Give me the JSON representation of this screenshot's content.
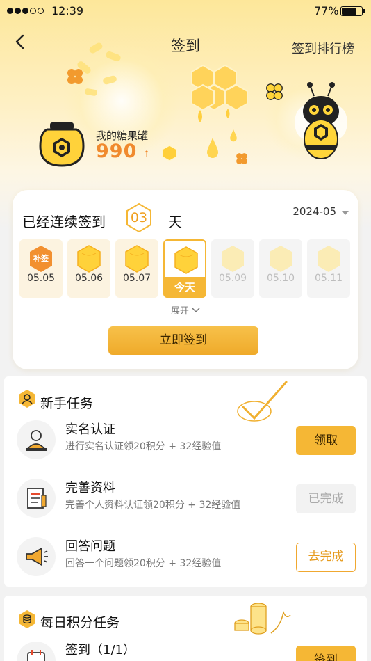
{
  "status_bar": {
    "time": "12:39",
    "battery_pct": "77%"
  },
  "nav": {
    "title": "签到",
    "ranking_label": "签到排行榜"
  },
  "jar": {
    "label": "我的糖果罐",
    "count": "990",
    "arrow": "↑"
  },
  "checkin": {
    "streak_prefix": "已经连续签到",
    "streak_days": "03",
    "streak_unit": "天",
    "month": "2024-05",
    "days": [
      {
        "date": "05.05",
        "state": "makeup",
        "badge": "补签"
      },
      {
        "date": "05.06",
        "state": "signed"
      },
      {
        "date": "05.07",
        "state": "signed"
      },
      {
        "date": "",
        "state": "today",
        "badge": "今天"
      },
      {
        "date": "05.09",
        "state": "future"
      },
      {
        "date": "05.10",
        "state": "future"
      },
      {
        "date": "05.11",
        "state": "future"
      }
    ],
    "expand_label": "展开",
    "button_label": "立即签到"
  },
  "newbie": {
    "title": "新手任务",
    "tasks": [
      {
        "title": "实名认证",
        "desc": "进行实名认证领20积分 + 32经验值",
        "button": "领取",
        "icon": "id-card-person-icon"
      },
      {
        "title": "完善资料",
        "desc": "完善个人资料认证领20积分 + 32经验值",
        "button": "已完成",
        "icon": "profile-document-icon"
      },
      {
        "title": "回答问题",
        "desc": "回答一个问题领20积分 + 32经验值",
        "button": "去完成",
        "icon": "megaphone-icon"
      }
    ]
  },
  "daily": {
    "title": "每日积分任务",
    "tasks": [
      {
        "title": "签到（1/1）",
        "button": "签到",
        "icon": "calendar-icon"
      }
    ]
  },
  "colors": {
    "accent": "#f5b735",
    "orange": "#f08a2e",
    "hero": "#fde79a"
  }
}
